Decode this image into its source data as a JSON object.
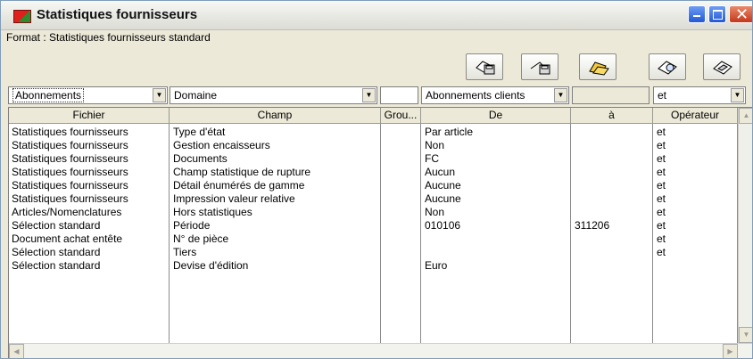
{
  "window": {
    "title": "Statistiques fournisseurs"
  },
  "format": {
    "label": "Format : Statistiques fournisseurs standard"
  },
  "filters": {
    "source": "Abonnements",
    "domain": "Domaine",
    "group": "",
    "de": "Abonnements clients",
    "a": "",
    "operator": "et"
  },
  "toolbar": {
    "buttons": [
      "save-icon",
      "open-save-icon",
      "folder-open-icon",
      "print-preview-icon",
      "delete-icon"
    ]
  },
  "table": {
    "columns": [
      "Fichier",
      "Champ",
      "Grou...",
      "De",
      "à",
      "Opérateur"
    ],
    "rows": [
      [
        "Statistiques fournisseurs",
        "Type d'état",
        "",
        "Par article",
        "",
        "et"
      ],
      [
        "Statistiques fournisseurs",
        "Gestion encaisseurs",
        "",
        "Non",
        "",
        "et"
      ],
      [
        "Statistiques fournisseurs",
        "Documents",
        "",
        "FC",
        "",
        "et"
      ],
      [
        "Statistiques fournisseurs",
        "Champ statistique de rupture",
        "",
        "Aucun",
        "",
        "et"
      ],
      [
        "Statistiques fournisseurs",
        "Détail énumérés de gamme",
        "",
        "Aucune",
        "",
        "et"
      ],
      [
        "Statistiques fournisseurs",
        "Impression valeur relative",
        "",
        "Aucune",
        "",
        "et"
      ],
      [
        "Articles/Nomenclatures",
        "Hors statistiques",
        "",
        "Non",
        "",
        "et"
      ],
      [
        "Sélection standard",
        "Période",
        "",
        "010106",
        "311206",
        "et"
      ],
      [
        "Document achat entête",
        "N° de pièce",
        "",
        "",
        "",
        "et"
      ],
      [
        "Sélection standard",
        "Tiers",
        "",
        "",
        "",
        "et"
      ],
      [
        "Sélection standard",
        "Devise d'édition",
        "",
        "Euro",
        "",
        ""
      ]
    ]
  }
}
